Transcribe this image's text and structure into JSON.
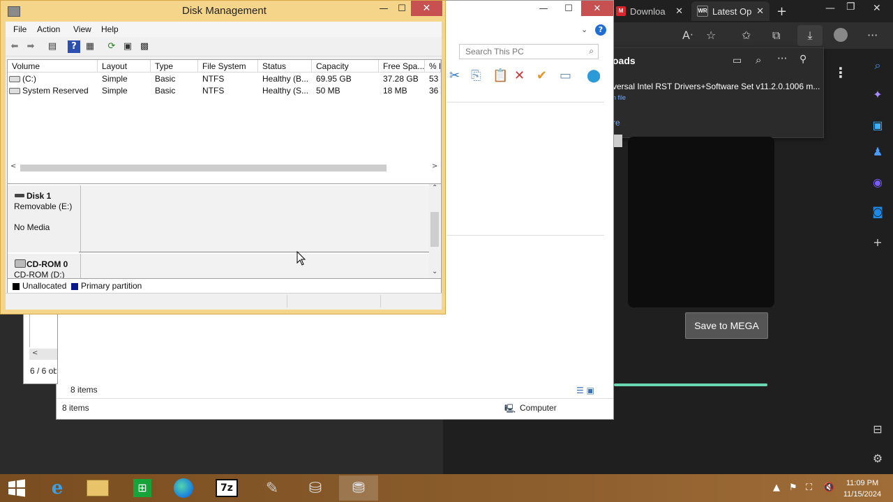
{
  "browser": {
    "tabs": [
      {
        "label": "Downloa",
        "favicon": "M"
      },
      {
        "label": "Latest Op",
        "favicon": "WR"
      }
    ],
    "downloads_panel": {
      "title": "oads",
      "file_name": "versal Intel RST Drivers+Software Set v11.2.0.1006 m...",
      "link": "n file",
      "more": "re"
    },
    "mega_button": "Save to MEGA"
  },
  "explorer": {
    "search_placeholder": "Search This PC",
    "items_count_top": "8 items",
    "items_count_bottom": "8 items",
    "location": "Computer",
    "mini_window_count": "6 / 6 ob"
  },
  "disk_management": {
    "title": "Disk Management",
    "menu": [
      "File",
      "Action",
      "View",
      "Help"
    ],
    "columns": [
      "Volume",
      "Layout",
      "Type",
      "File System",
      "Status",
      "Capacity",
      "Free Spa...",
      "% F"
    ],
    "rows": [
      [
        "(C:)",
        "Simple",
        "Basic",
        "NTFS",
        "Healthy (B...",
        "69.95 GB",
        "37.28 GB",
        "53"
      ],
      [
        "System Reserved",
        "Simple",
        "Basic",
        "NTFS",
        "Healthy (S...",
        "50 MB",
        "18 MB",
        "36"
      ]
    ],
    "disks": [
      {
        "name": "Disk 1",
        "line2": "Removable (E:)",
        "line3": "No Media"
      },
      {
        "name": "CD-ROM 0",
        "line2": "CD-ROM (D:)"
      }
    ],
    "legend": [
      {
        "label": "Unallocated",
        "color": "#000000"
      },
      {
        "label": "Primary partition",
        "color": "#0a1a8a"
      }
    ]
  },
  "taskbar": {
    "time": "11:09 PM",
    "date": "11/15/2024",
    "apps": [
      "internet-explorer",
      "file-explorer",
      "store",
      "edge",
      "7zip",
      "tool",
      "disk-utility",
      "disk-management"
    ]
  },
  "colors": {
    "dm_frame": "#f5d58a",
    "close_red": "#c75050",
    "taskbar": "#8a5b2a",
    "edge_dark": "#1f1f1f"
  }
}
